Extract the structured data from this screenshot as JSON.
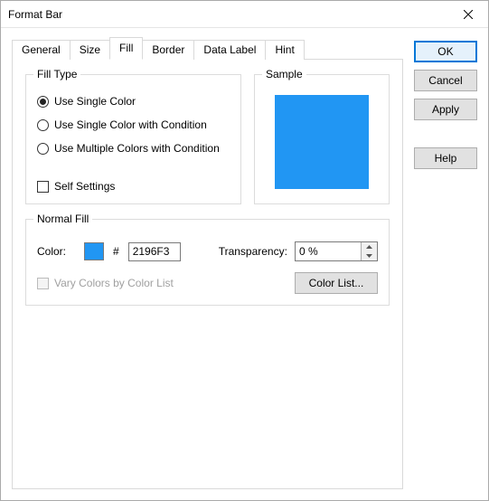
{
  "window": {
    "title": "Format Bar"
  },
  "tabs": [
    {
      "label": "General"
    },
    {
      "label": "Size"
    },
    {
      "label": "Fill"
    },
    {
      "label": "Border"
    },
    {
      "label": "Data Label"
    },
    {
      "label": "Hint"
    }
  ],
  "active_tab": "Fill",
  "buttons": {
    "ok": "OK",
    "cancel": "Cancel",
    "apply": "Apply",
    "help": "Help"
  },
  "fillType": {
    "legend": "Fill Type",
    "options": [
      "Use Single Color",
      "Use Single Color with Condition",
      "Use Multiple Colors with Condition"
    ],
    "selected": 0,
    "selfSettings": "Self Settings"
  },
  "sample": {
    "legend": "Sample",
    "color": "#2196F3"
  },
  "normalFill": {
    "legend": "Normal Fill",
    "colorLabel": "Color:",
    "hexValue": "2196F3",
    "transparencyLabel": "Transparency:",
    "transparencyValue": "0 %",
    "varyColors": "Vary Colors by Color List",
    "colorListBtn": "Color List..."
  }
}
